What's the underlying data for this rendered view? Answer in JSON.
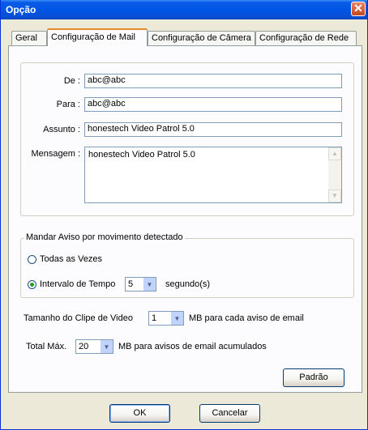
{
  "window": {
    "title": "Opção",
    "close_symbol": "✕"
  },
  "tabs": [
    {
      "label": "Geral"
    },
    {
      "label": "Configuração de Mail",
      "selected": true
    },
    {
      "label": "Configuração de Câmera"
    },
    {
      "label": "Configuração de Rede"
    }
  ],
  "mail": {
    "from_label": "De :",
    "from_value": "abc@abc",
    "to_label": "Para :",
    "to_value": "abc@abc",
    "subject_label": "Assunto :",
    "subject_value": "honestech Video Patrol 5.0",
    "message_label": "Mensagem :",
    "message_value": "honestech Video Patrol 5.0"
  },
  "alert": {
    "group_title": "Mandar Aviso por movimento detectado",
    "option_always": "Todas as Vezes",
    "option_interval": "Intervalo de Tempo",
    "selected_option": "Intervalo de Tempo",
    "interval_value": "5",
    "interval_unit": "segundo(s)"
  },
  "clip": {
    "label": "Tamanho do Clipe de Video",
    "value": "1",
    "unit": "MB para cada aviso de email"
  },
  "total": {
    "label": "Total Máx.",
    "value": "20",
    "unit": "MB para avisos de email acumulados"
  },
  "buttons": {
    "default": "Padrão",
    "ok": "OK",
    "cancel": "Cancelar"
  }
}
